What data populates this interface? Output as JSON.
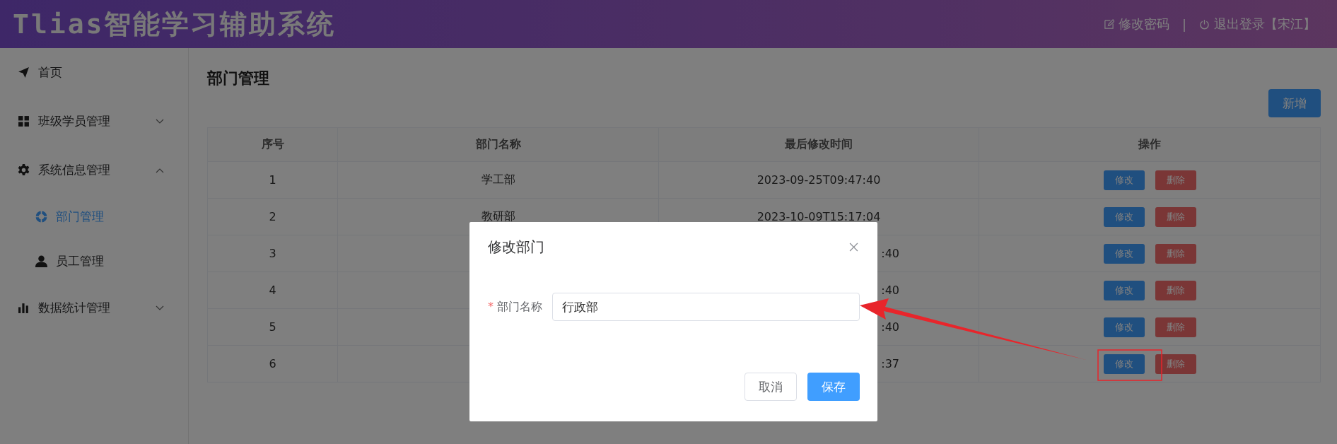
{
  "header": {
    "title": "Tlias智能学习辅助系统",
    "links": [
      {
        "label": "修改密码"
      },
      {
        "label": "退出登录【宋江】"
      }
    ],
    "separator": "|"
  },
  "sidebar": {
    "items": [
      {
        "label": "首页"
      },
      {
        "label": "班级学员管理",
        "expanded": false
      },
      {
        "label": "系统信息管理",
        "expanded": true,
        "children": [
          {
            "label": "部门管理",
            "selected": true
          },
          {
            "label": "员工管理",
            "selected": false
          }
        ]
      },
      {
        "label": "数据统计管理",
        "expanded": false
      }
    ]
  },
  "page_title": "部门管理",
  "add_button": "新增",
  "table": {
    "columns": [
      "序号",
      "部门名称",
      "最后修改时间",
      "操作"
    ],
    "rows": [
      {
        "index": "1",
        "name": "学工部",
        "time": "2023-09-25T09:47:40",
        "covered": false,
        "actions": [
          "修改",
          "删除"
        ]
      },
      {
        "index": "2",
        "name": "教研部",
        "time": "2023-10-09T15:17:04",
        "covered": false,
        "actions": [
          "修改",
          "删除"
        ]
      },
      {
        "index": "3",
        "time": ":40",
        "covered": true,
        "actions": [
          "修改",
          "删除"
        ]
      },
      {
        "index": "4",
        "time": ":40",
        "covered": true,
        "actions": [
          "修改",
          "删除"
        ]
      },
      {
        "index": "5",
        "time": ":40",
        "covered": true,
        "actions": [
          "修改",
          "删除"
        ]
      },
      {
        "index": "6",
        "time": ":37",
        "covered": true,
        "actions": [
          "修改",
          "删除"
        ]
      }
    ]
  },
  "dialog": {
    "title": "修改部门",
    "field": {
      "marker": "*",
      "label": "部门名称",
      "value": "行政部"
    },
    "buttons": [
      {
        "label": "取消",
        "kind": "default"
      },
      {
        "label": "保存",
        "kind": "primary"
      }
    ]
  }
}
